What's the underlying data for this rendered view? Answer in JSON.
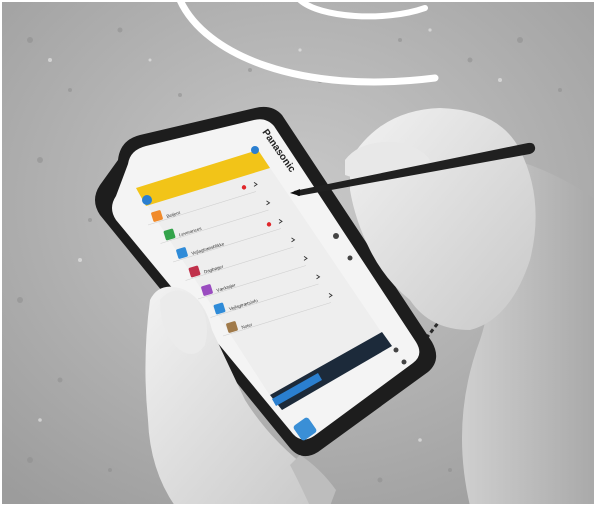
{
  "photo": {
    "device_brand": "Panasonic",
    "app_header_title": "",
    "menu_items": [
      {
        "label": "Betjent",
        "icon_color": "#f08a2a",
        "has_badge": true
      },
      {
        "label": "Leverances",
        "icon_color": "#33a34a",
        "has_badge": false
      },
      {
        "label": "Vejlagtrætsblikke",
        "icon_color": "#2f8bd8",
        "has_badge": true
      },
      {
        "label": "Dagbøger",
        "icon_color": "#c0304a",
        "has_badge": false
      },
      {
        "label": "Værktøjer",
        "icon_color": "#9a4cc0",
        "has_badge": false
      },
      {
        "label": "Vejlagtrætsinfo",
        "icon_color": "#2f8bd8",
        "has_badge": false
      },
      {
        "label": "Noter",
        "icon_color": "#a07a4a",
        "has_badge": false
      }
    ],
    "colors": {
      "header_yellow": "#f2c418",
      "badge_red": "#e0262a",
      "home_blue": "#2a7fd0",
      "taskbar_dark": "#1c2a3a"
    }
  }
}
